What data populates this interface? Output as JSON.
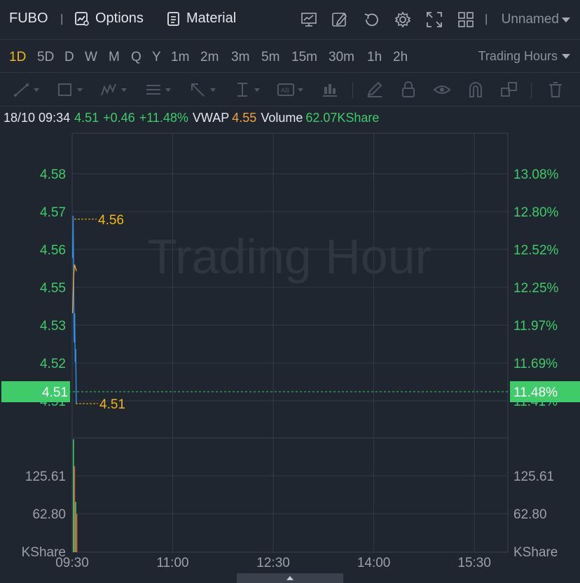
{
  "header": {
    "symbol": "FUBO",
    "separator": "|",
    "options_label": "Options",
    "material_label": "Material",
    "layout_name": "Unnamed",
    "icons": [
      "chart-template-icon",
      "draw-edit-icon",
      "refresh-icon",
      "settings-icon",
      "fullscreen-icon",
      "grid-layout-icon"
    ]
  },
  "periods": {
    "items": [
      "1D",
      "5D",
      "D",
      "W",
      "M",
      "Q",
      "Y",
      "1m",
      "2m",
      "3m",
      "5m",
      "15m",
      "30m",
      "1h",
      "2h"
    ],
    "active": "1D",
    "session_label": "Trading Hours"
  },
  "drawing_tools": [
    "trend-line-icon",
    "rectangle-icon",
    "pattern-icon",
    "fib-icon",
    "arrow-icon",
    "measure-icon",
    "text-note-icon",
    "indicator-icon",
    "pencil-icon",
    "lock-icon",
    "eye-icon",
    "magnet-icon",
    "layers-icon",
    "trash-icon"
  ],
  "quote": {
    "datetime": "18/10 09:34",
    "price": "4.51",
    "change": "+0.46",
    "change_pct": "+11.48%",
    "vwap_label": "VWAP",
    "vwap_value": "4.55",
    "volume_label": "Volume",
    "volume_value": "62.07KShare"
  },
  "colors": {
    "background": "#1f2630",
    "up_green": "#3fcb6a",
    "down_red": "#e0533e",
    "price_line": "#2f8de4",
    "vwap_line": "#f1a33a",
    "highlight_yellow": "#f0b90b"
  },
  "chart_data": {
    "type": "line",
    "watermark": "Trading Hour",
    "x_ticks": [
      "09:30",
      "11:00",
      "12:30",
      "14:00",
      "15:30"
    ],
    "y_ticks_left": [
      "4.58",
      "4.57",
      "4.56",
      "4.55",
      "4.53",
      "4.52",
      "4.51"
    ],
    "y_ticks_right": [
      "13.08%",
      "12.80%",
      "12.52%",
      "12.25%",
      "11.97%",
      "11.69%",
      "11.41%"
    ],
    "current_price_label": "4.51",
    "current_pct_label": "11.48%",
    "high_label": "4.56",
    "low_label": "4.51",
    "series": [
      {
        "name": "Price",
        "points": [
          [
            "09:30",
            4.554
          ],
          [
            "09:30",
            4.567
          ],
          [
            "09:31",
            4.549
          ],
          [
            "09:31",
            4.528
          ],
          [
            "09:32",
            4.537
          ],
          [
            "09:32",
            4.522
          ],
          [
            "09:33",
            4.526
          ],
          [
            "09:34",
            4.509
          ]
        ]
      },
      {
        "name": "VWAP",
        "points": [
          [
            "09:30",
            4.537
          ],
          [
            "09:31",
            4.548
          ],
          [
            "09:32",
            4.552
          ],
          [
            "09:33",
            4.551
          ],
          [
            "09:34",
            4.55
          ]
        ]
      }
    ],
    "volume": {
      "label": "KShare",
      "ticks": [
        "125.61",
        "62.80"
      ],
      "bars": [
        {
          "time": "09:30",
          "value": 184,
          "direction": "up"
        },
        {
          "time": "09:31",
          "value": 140,
          "direction": "down"
        },
        {
          "time": "09:32",
          "value": 82,
          "direction": "up"
        },
        {
          "time": "09:33",
          "value": 62,
          "direction": "down"
        }
      ]
    }
  }
}
